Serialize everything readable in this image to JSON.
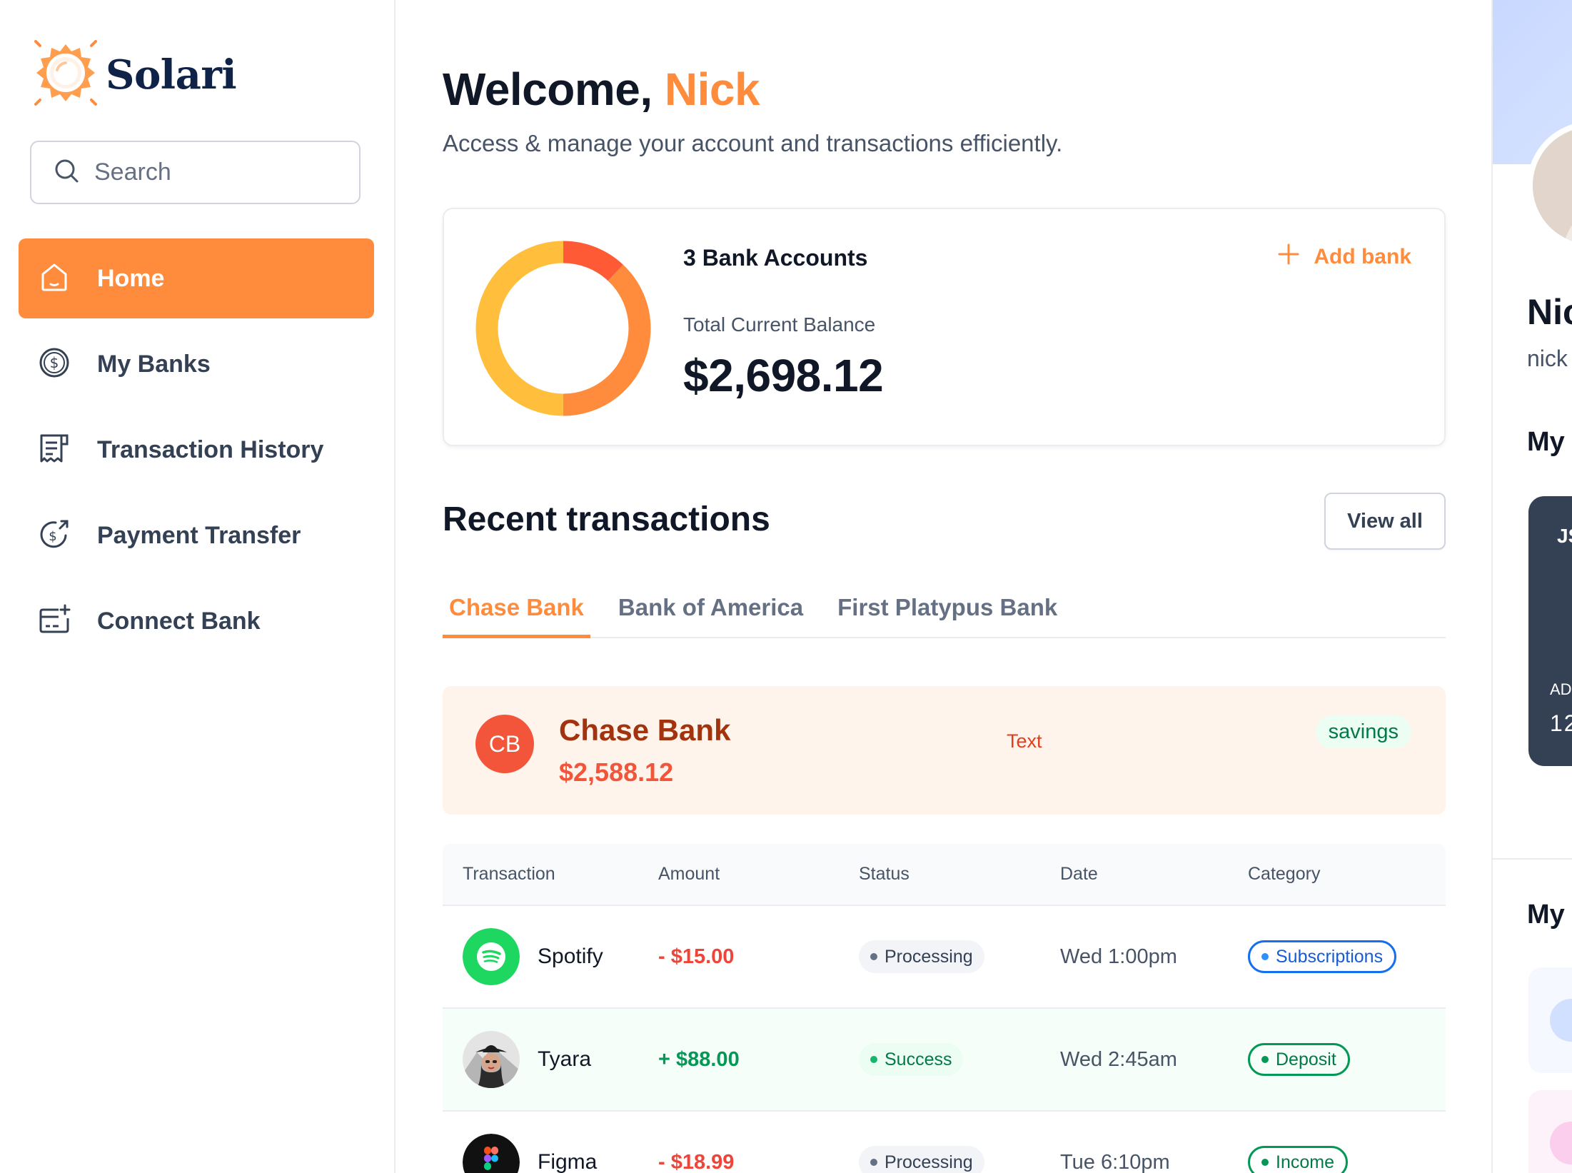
{
  "brand": {
    "name": "Solari",
    "logo_icon": "sun-logo-icon",
    "accent": "#ff8c3c"
  },
  "search": {
    "placeholder": "Search",
    "value": ""
  },
  "sidebar": {
    "items": [
      {
        "label": "Home",
        "icon": "home-icon",
        "active": true
      },
      {
        "label": "My Banks",
        "icon": "dollar-circle-icon",
        "active": false
      },
      {
        "label": "Transaction History",
        "icon": "receipt-icon",
        "active": false
      },
      {
        "label": "Payment Transfer",
        "icon": "money-send-icon",
        "active": false
      },
      {
        "label": "Connect Bank",
        "icon": "credit-card-add-icon",
        "active": false
      }
    ]
  },
  "header": {
    "greeting": "Welcome,",
    "user_first_name": "Nick",
    "subtitle": "Access & manage your account and transactions efficiently."
  },
  "balance": {
    "bank_count_label": "3 Bank Accounts",
    "total_label": "Total Current Balance",
    "total_amount": "$2,698.12",
    "add_bank_label": "Add bank",
    "donut_segments": [
      {
        "fraction": 0.12,
        "color": "#ff5a36"
      },
      {
        "fraction": 0.38,
        "color": "#ff8c3c"
      },
      {
        "fraction": 0.5,
        "color": "#ffbf3c"
      }
    ]
  },
  "recent": {
    "title": "Recent transactions",
    "view_all_label": "View all",
    "tabs": [
      {
        "label": "Chase Bank",
        "active": true
      },
      {
        "label": "Bank of America",
        "active": false
      },
      {
        "label": "First Platypus Bank",
        "active": false
      }
    ],
    "selected_bank": {
      "initials": "CB",
      "name": "Chase Bank",
      "balance": "$2,588.12",
      "text": "Text",
      "type": "savings"
    },
    "table": {
      "headers": [
        "Transaction",
        "Amount",
        "Status",
        "Date",
        "Category"
      ],
      "rows": [
        {
          "name": "Spotify",
          "logo": "spotify-logo-icon",
          "amount": "- $15.00",
          "amount_sign": "neg",
          "status": "Processing",
          "date": "Wed 1:00pm",
          "category": "Subscriptions",
          "category_color": "blue"
        },
        {
          "name": "Tyara",
          "logo": "user-photo-avatar",
          "amount": "+ $88.00",
          "amount_sign": "pos",
          "status": "Success",
          "date": "Wed 2:45am",
          "category": "Deposit",
          "category_color": "green"
        },
        {
          "name": "Figma",
          "logo": "figma-logo-icon",
          "amount": "- $18.99",
          "amount_sign": "neg",
          "status": "Processing",
          "date": "Tue 6:10pm",
          "category": "Income",
          "category_color": "green"
        }
      ]
    }
  },
  "right_panel": {
    "name": "Nic",
    "email": "nick",
    "my_banks_title": "My",
    "card_holder": "JS",
    "card_label": "AD",
    "card_number": "12",
    "my_budgets_title": "My"
  }
}
